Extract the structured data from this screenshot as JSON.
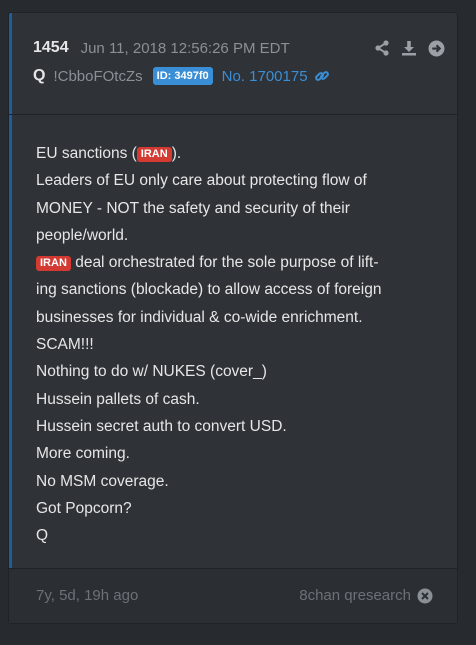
{
  "post": {
    "number": "1454",
    "timestamp": "Jun 11, 2018 12:56:26 PM EDT",
    "author": "Q",
    "tripcode": "!CbboFOtcZs",
    "id_badge": "ID: 3497f0",
    "post_link": "No. 1700175"
  },
  "actions": [
    "share-icon",
    "download-icon",
    "forward-icon"
  ],
  "message": {
    "l1a": "EU sanctions (",
    "tag": "IRAN",
    "l1b": ").",
    "l2": "Leaders of EU only care about protecting flow of",
    "l3": "MONEY - NOT the safety and security of their",
    "l4": "people/world.",
    "l5b": " deal orchestrated for the sole purpose of lift-",
    "l6": "ing sanctions (blockade) to allow access of foreign",
    "l7": "businesses for individual & co-wide enrichment.",
    "l8": "SCAM!!!",
    "l9": "Nothing to do w/ NUKES (cover_)",
    "l10": "Hussein pallets of cash.",
    "l11": "Hussein secret auth to convert USD.",
    "l12": "More coming.",
    "l13": "No MSM coverage.",
    "l14": "Got Popcorn?",
    "l15": "Q"
  },
  "footer": {
    "age": "7y, 5d, 19h ago",
    "source": "8chan qresearch"
  },
  "colors": {
    "background": "#272b30",
    "card": "#2f3338",
    "accent_blue": "#3a8ed6",
    "tag_red": "#d33a32"
  }
}
